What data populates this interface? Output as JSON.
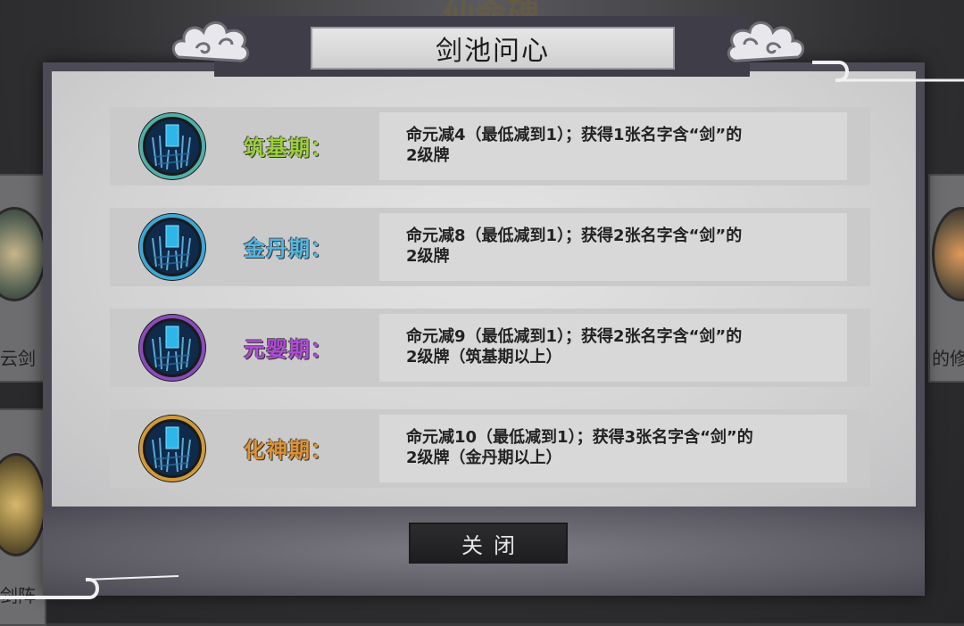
{
  "background": {
    "title": "仙命碑",
    "left_label_1": "云剑",
    "right_label_1": "的修",
    "left_label_2": "剑阵"
  },
  "dialog": {
    "title": "剑池问心",
    "close_label": "关闭",
    "rows": [
      {
        "stage": "筑基期：",
        "stage_color": "#9bd037",
        "ring_color": "#4fb0a8",
        "desc_line1": "命元减4（最低减到1）；获得1张名字含“剑”的",
        "desc_line2": "2级牌"
      },
      {
        "stage": "金丹期：",
        "stage_color": "#4fb8e6",
        "ring_color": "#3da7d6",
        "desc_line1": "命元减8（最低减到1）；获得2张名字含“剑”的",
        "desc_line2": "2级牌"
      },
      {
        "stage": "元婴期：",
        "stage_color": "#b04ad8",
        "ring_color": "#8a4bbd",
        "desc_line1": "命元减9（最低减到1）；获得2张名字含“剑”的",
        "desc_line2": "2级牌（筑基期以上）"
      },
      {
        "stage": "化神期：",
        "stage_color": "#e0922e",
        "ring_color": "#d09a3a",
        "desc_line1": "命元减10（最低减到1）；获得3张名字含“剑”的",
        "desc_line2": "2级牌（金丹期以上）"
      }
    ]
  }
}
